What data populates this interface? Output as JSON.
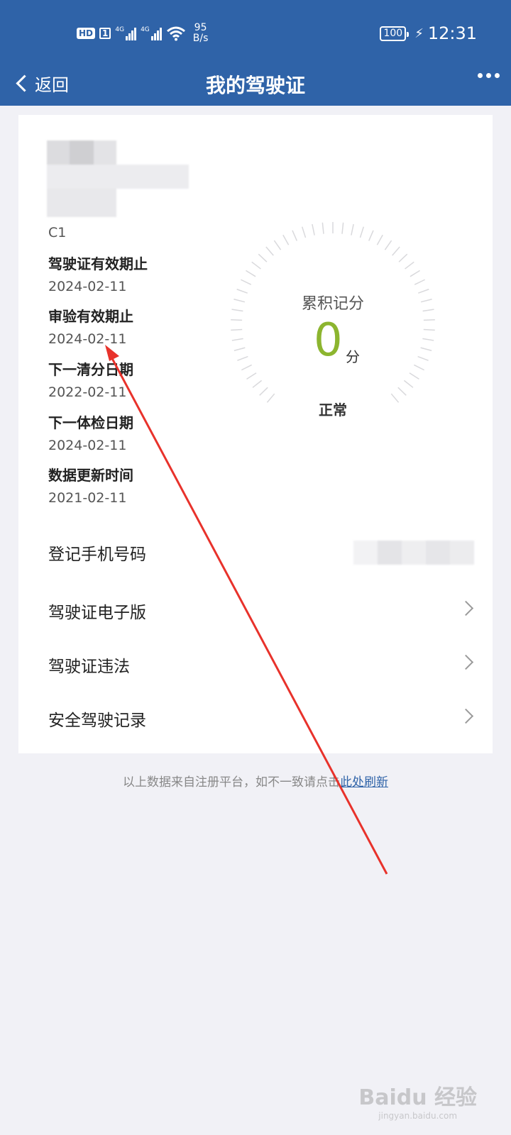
{
  "status_bar": {
    "hd": "HD",
    "sim": "1",
    "signal1": "4G",
    "signal2": "4G",
    "net_speed_value": "95",
    "net_speed_unit": "B/s",
    "battery": "100",
    "time": "12:31"
  },
  "nav": {
    "back_label": "返回",
    "title": "我的驾驶证"
  },
  "license": {
    "class": "C1",
    "fields": [
      {
        "label": "驾驶证有效期止",
        "value": "2024-02-11"
      },
      {
        "label": "审验有效期止",
        "value": "2024-02-11"
      },
      {
        "label": "下一清分日期",
        "value": "2022-02-11"
      },
      {
        "label": "下一体检日期",
        "value": "2024-02-11"
      },
      {
        "label": "数据更新时间",
        "value": "2021-02-11"
      }
    ]
  },
  "score": {
    "label": "累积记分",
    "value": "0",
    "unit": "分",
    "status": "正常",
    "value_color": "#8cb52f"
  },
  "menu": [
    {
      "label": "登记手机号码"
    },
    {
      "label": "驾驶证电子版"
    },
    {
      "label": "驾驶证违法"
    },
    {
      "label": "安全驾驶记录"
    }
  ],
  "footer": {
    "note": "以上数据来自注册平台，如不一致请点击",
    "link": "此处刷新"
  },
  "watermark": {
    "main": "Baidu 经验",
    "sub": "jingyan.baidu.com"
  },
  "colors": {
    "header": "#2f63a8",
    "annotation_arrow": "#e8322b"
  },
  "icons": {
    "back": "chevron-left-icon",
    "more": "more-dots-icon",
    "row": "chevron-right-icon"
  }
}
